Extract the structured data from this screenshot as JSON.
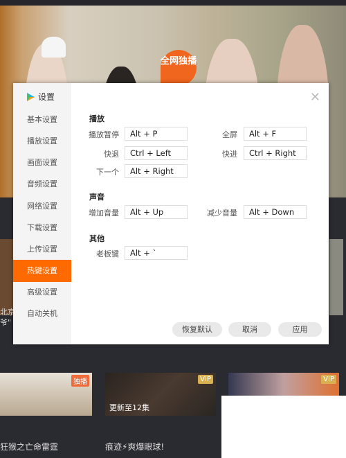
{
  "banner": {
    "badge": "全网独播",
    "left_text": "北京",
    "left_text2": "爷\""
  },
  "dialog": {
    "title": "设置",
    "close_icon": "close-icon",
    "nav": [
      "基本设置",
      "播放设置",
      "画面设置",
      "音频设置",
      "网络设置",
      "下载设置",
      "上传设置",
      "热键设置",
      "高级设置",
      "自动关机"
    ],
    "active_index": 7,
    "accent": "#ff6a00",
    "sections": {
      "play": {
        "title": "播放",
        "pause_label": "播放暂停",
        "pause": "Alt + P",
        "fullscreen_label": "全屏",
        "fullscreen": "Alt + F",
        "rewind_label": "快退",
        "rewind": "Ctrl + Left",
        "forward_label": "快进",
        "forward": "Ctrl + Right",
        "next_label": "下一个",
        "next": "Alt + Right"
      },
      "sound": {
        "title": "声音",
        "up_label": "增加音量",
        "up": "Alt + Up",
        "down_label": "减少音量",
        "down": "Alt + Down"
      },
      "other": {
        "title": "其他",
        "boss_label": "老板键",
        "boss": "Alt + `"
      }
    },
    "buttons": {
      "restore": "恢复默认",
      "cancel": "取消",
      "apply": "应用"
    }
  },
  "cards": [
    {
      "tag": "独播",
      "title": "狂猴之亡命雷霆"
    },
    {
      "tag": "VIP",
      "overlay": "更新至12集",
      "title": "痕迹⚡爽爆眼球!"
    },
    {
      "tag": "VIP"
    }
  ]
}
